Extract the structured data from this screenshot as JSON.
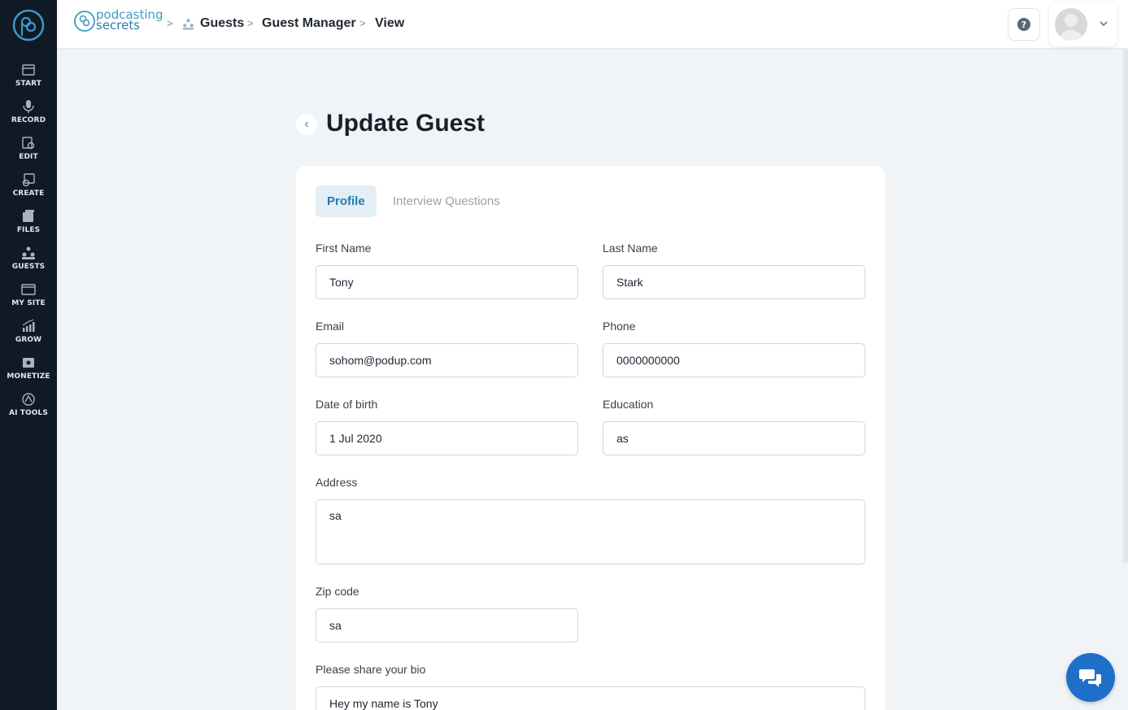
{
  "sidebar": {
    "items": [
      {
        "label": "START",
        "icon": "start-icon"
      },
      {
        "label": "RECORD",
        "icon": "microphone-icon"
      },
      {
        "label": "EDIT",
        "icon": "edit-icon"
      },
      {
        "label": "CREATE",
        "icon": "create-icon"
      },
      {
        "label": "FILES",
        "icon": "files-icon"
      },
      {
        "label": "GUESTS",
        "icon": "guests-icon"
      },
      {
        "label": "MY SITE",
        "icon": "site-icon"
      },
      {
        "label": "GROW",
        "icon": "grow-icon"
      },
      {
        "label": "MONETIZE",
        "icon": "monetize-icon"
      },
      {
        "label": "AI TOOLS",
        "icon": "ai-tools-icon"
      }
    ]
  },
  "header": {
    "brand_line1": "podcasting",
    "brand_line2": "secrets",
    "breadcrumb": [
      "Guests",
      "Guest Manager",
      "View"
    ]
  },
  "page": {
    "title": "Update Guest",
    "tabs": [
      {
        "label": "Profile",
        "active": true
      },
      {
        "label": "Interview Questions",
        "active": false
      }
    ]
  },
  "form": {
    "first_name": {
      "label": "First Name",
      "value": "Tony"
    },
    "last_name": {
      "label": "Last Name",
      "value": "Stark"
    },
    "email": {
      "label": "Email",
      "value": "sohom@podup.com"
    },
    "phone": {
      "label": "Phone",
      "value": "0000000000"
    },
    "dob": {
      "label": "Date of birth",
      "value": "1 Jul 2020"
    },
    "education": {
      "label": "Education",
      "value": "as"
    },
    "address": {
      "label": "Address",
      "value": "sa"
    },
    "zip": {
      "label": "Zip code",
      "value": "sa"
    },
    "bio": {
      "label": "Please share your bio",
      "value": "Hey my name is Tony"
    }
  },
  "colors": {
    "sidebar_bg": "#0f1a24",
    "accent": "#1d7eb3",
    "brand": "#3a9bc8",
    "chat_button": "#1e6fc8"
  }
}
